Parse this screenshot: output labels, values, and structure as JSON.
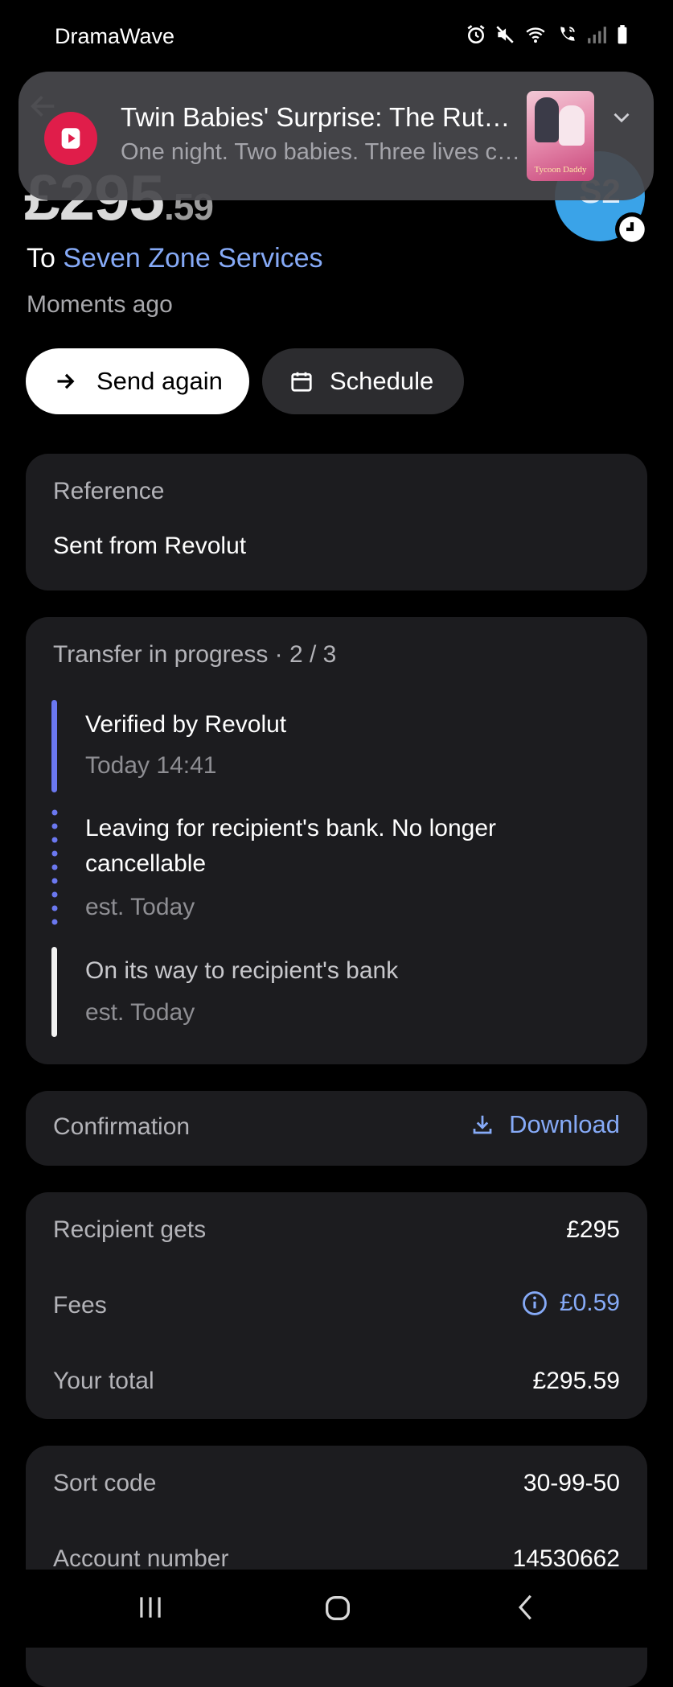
{
  "status_bar": {
    "app_name": "DramaWave"
  },
  "notification": {
    "title": "Twin Babies' Surprise: The Ruthless Tycoon Daddy",
    "body": "One night. Two babies. Three lives changed forever.",
    "thumbnail_text": "Tycoon Daddy"
  },
  "header": {
    "amount_main": "£295",
    "amount_decimal": ".59",
    "avatar_initials": "S2",
    "to_prefix": "To",
    "recipient": "Seven Zone Services",
    "time_ago": "Moments ago"
  },
  "actions": {
    "send_again": "Send again",
    "schedule": "Schedule"
  },
  "reference": {
    "label": "Reference",
    "value": "Sent from Revolut"
  },
  "progress": {
    "title": "Transfer in progress · 2 / 3",
    "steps": [
      {
        "title": "Verified by Revolut",
        "sub": "Today 14:41"
      },
      {
        "title": "Leaving for recipient's bank. No longer cancellable",
        "sub": "est. Today"
      },
      {
        "title": "On its way to recipient's bank",
        "sub": "est. Today"
      }
    ]
  },
  "confirmation": {
    "label": "Confirmation",
    "download": "Download"
  },
  "summary": {
    "recipient_gets_label": "Recipient gets",
    "recipient_gets_value": "£295",
    "fees_label": "Fees",
    "fees_value": "£0.59",
    "total_label": "Your total",
    "total_value": "£295.59"
  },
  "account": {
    "sort_code_label": "Sort code",
    "sort_code_value": "30-99-50",
    "account_number_label": "Account number",
    "account_number_value": "14530662"
  },
  "colors": {
    "accent": "#86aaf7",
    "card": "#1c1c1f",
    "avatar": "#3aa3e8",
    "notification_icon": "#e01d4a"
  }
}
